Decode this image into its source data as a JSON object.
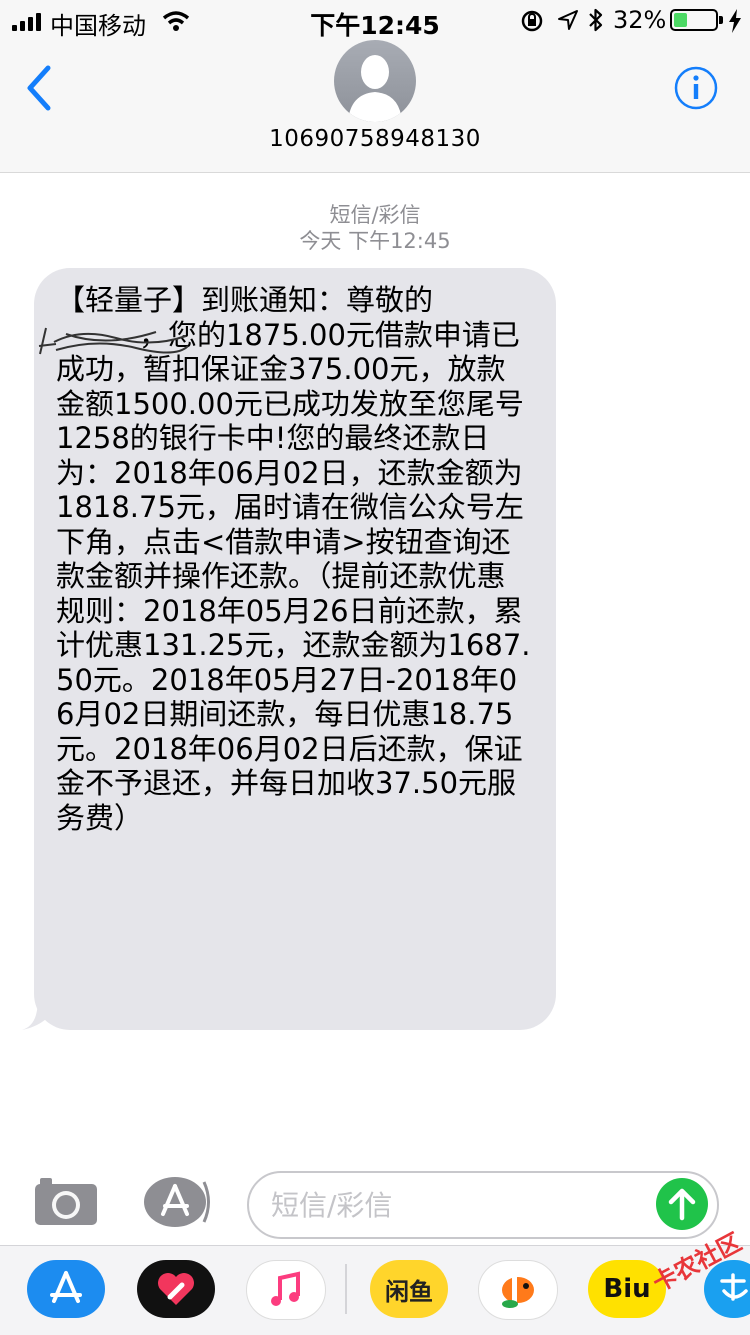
{
  "status_bar": {
    "carrier": "中国移动",
    "time": "下午12:45",
    "battery_percent": "32%",
    "battery_level": 0.32,
    "battery_color": "#4cd964"
  },
  "header": {
    "back_icon": "chevron-left-icon",
    "contact_number": "10690758948130",
    "info_icon": "info-icon",
    "accent": "#147efb"
  },
  "conversation": {
    "message_type": "短信/彩信",
    "timestamp": "今天 下午12:45",
    "message_text": "【轻量子】到账通知：尊敬的\n         ，您的1875.00元借款申请已成功，暂扣保证金375.00元，放款金额1500.00元已成功发放至您尾号1258的银行卡中!您的最终还款日为：2018年06月02日，还款金额为1818.75元，届时请在微信公众号左下角，点击<借款申请>按钮查询还款金额并操作还款。（提前还款优惠规则：2018年05月26日前还款，累计优惠131.25元，还款金额为1687.50元。2018年05月27日-2018年06月02日期间还款，每日优惠18.75元。2018年06月02日后还款，保证金不予退还，并每日加收37.50元服务费）",
    "bubble_color": "#e5e5ea"
  },
  "compose": {
    "placeholder": "短信/彩信",
    "send_color": "#20c34a"
  },
  "app_drawer": {
    "apps": [
      {
        "icon": "app-store-icon"
      },
      {
        "icon": "digital-touch-icon"
      },
      {
        "icon": "music-icon"
      },
      {
        "icon": "xianyu-icon",
        "label": "闲鱼"
      },
      {
        "icon": "clownfish-icon"
      },
      {
        "icon": "biu-icon",
        "label": "Biu"
      },
      {
        "icon": "alipay-icon"
      }
    ]
  },
  "watermark": "卡农社区"
}
